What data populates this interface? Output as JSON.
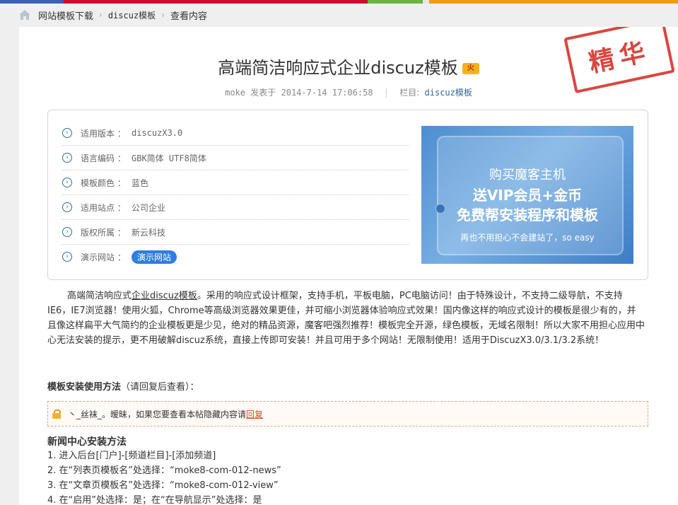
{
  "breadcrumb": {
    "items": [
      "网站模板下载",
      "discuz模板",
      "查看内容"
    ]
  },
  "stamp": "精华",
  "article": {
    "title": "高端简洁响应式企业discuz模板",
    "hot_badge": "火",
    "author": "moke",
    "posted_label": "发表于",
    "date": "2014-7-14 17:06:58",
    "column_label": "栏目:",
    "column": "discuz模板"
  },
  "info": {
    "rows": [
      {
        "label": "适用版本 ：",
        "value": "discuzX3.0"
      },
      {
        "label": "语言编码 ：",
        "value": "GBK简体 UTF8简体"
      },
      {
        "label": "模板颜色 ：",
        "value": "蓝色"
      },
      {
        "label": "适用站点 ：",
        "value": "公司企业"
      },
      {
        "label": "版权所属 ：",
        "value": "新云科技"
      },
      {
        "label": "演示网站 ：",
        "value": "演示网站"
      }
    ]
  },
  "ad": {
    "line1": "购买魔客主机",
    "line2": "送VIP会员+金币",
    "line3": "免费帮安装程序和模板",
    "line4": "再也不用担心不会建站了，so easy"
  },
  "body": {
    "lead": "高端简洁响应式",
    "link": "企业discuz模板",
    "rest": "。采用的响应式设计框架，支持手机，平板电脑，PC电脑访问！由于特殊设计，不支持二级导航，不支持IE6，IE7浏览器！使用火狐，Chrome等高级浏览器效果更佳，并可缩小浏览器体验响应式效果！国内像这样的响应式设计的模板是很少有的，并且像这样扁平大气简约的企业模板更是少见，绝对的精品资源，魔客吧强烈推荐！模板完全开源，绿色模板，无域名限制！所以大家不用担心应用中心无法安装的提示，更不用破解discuz系统，直接上传即可安装！并且可用于多个网站！无限制使用！适用于DiscuzX3.0/3.1/3.2系统！"
  },
  "howto": {
    "title": "模板安装使用方法",
    "note": "（请回复后查看）："
  },
  "hidden": {
    "prefix": "丶_丝袜_。暧昧，如果您要查看本帖隐藏内容请",
    "link": "回复"
  },
  "news": {
    "title": "新闻中心安装方法",
    "steps": [
      "1. 进入后台[门户]-[频道栏目]-[添加频道]",
      "2. 在“列表页模板名”处选择：“moke8-com-012-news”",
      "3. 在“文章页模板名”处选择：“moke8-com-012-view”",
      "4. 在“启用”处选择：是；在“在导航显示”处选择：是"
    ]
  }
}
